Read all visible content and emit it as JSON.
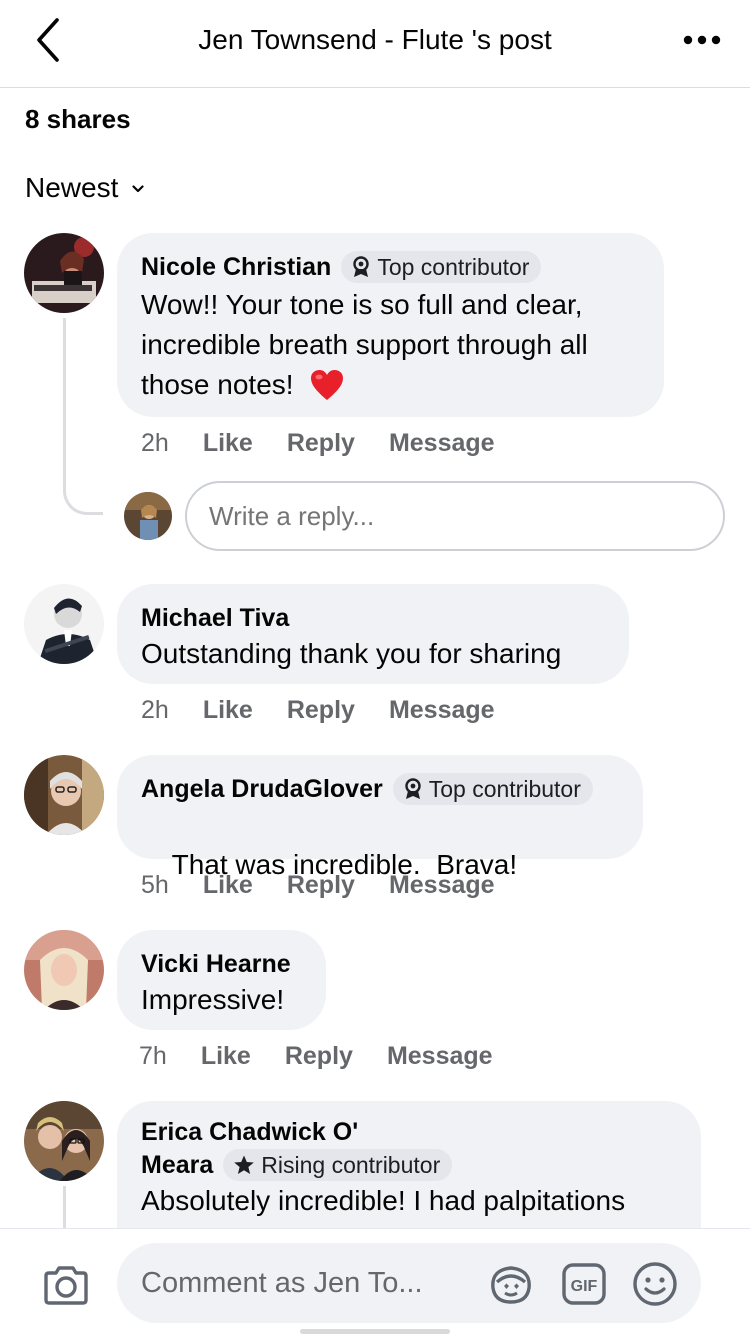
{
  "header": {
    "title": "Jen Townsend - Flute 's post",
    "back_icon": "chevron-left-icon",
    "more_icon": "more-horizontal-icon"
  },
  "shares": "8 shares",
  "sort": {
    "label": "Newest",
    "icon": "chevron-down-icon"
  },
  "comments": [
    {
      "author": "Nicole Christian",
      "badge": "Top contributor",
      "text": "Wow!! Your tone is so full and clear, incredible breath support through all those notes!",
      "emoji": "❤️",
      "time": "2h"
    },
    {
      "author": "Michael Tiva",
      "badge": "",
      "text": "Outstanding thank you for sharing",
      "time": "2h"
    },
    {
      "author": "Angela DrudaGlover",
      "badge": "Top contributor",
      "text": "That was incredible.  Brava!",
      "time": "5h"
    },
    {
      "author": "Vicki Hearne",
      "badge": "",
      "text": "Impressive!",
      "time": "7h"
    },
    {
      "author_line1": "Erica Chadwick O'",
      "author_line2": "Meara",
      "badge": "Rising contributor",
      "text": "Absolutely incredible! I had palpitations",
      "time": ""
    }
  ],
  "actions": {
    "like": "Like",
    "reply": "Reply",
    "message": "Message"
  },
  "reply_input": {
    "placeholder": "Write a reply..."
  },
  "composer": {
    "placeholder": "Comment as Jen To...",
    "camera_icon": "camera-icon",
    "avatar_sticker_icon": "avatar-sticker-icon",
    "gif_label": "GIF",
    "emoji_icon": "smiley-icon"
  },
  "colors": {
    "bubble": "#f0f2f5",
    "badge": "#e4e6eb",
    "secondary_text": "#65676b",
    "heart": "#f02849"
  }
}
